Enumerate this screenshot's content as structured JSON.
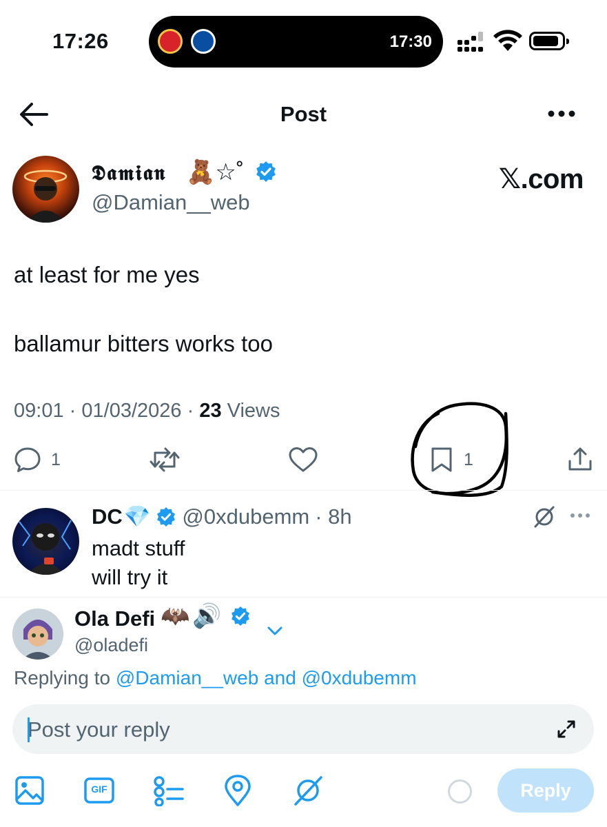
{
  "status_bar": {
    "time": "17:26",
    "live_activity_time": "17:30",
    "live_activity_icons": [
      "arsenal-crest-icon",
      "chelsea-crest-icon"
    ],
    "indicators": [
      "cellular-signal-icon",
      "wifi-icon",
      "battery-icon"
    ]
  },
  "header": {
    "title": "Post",
    "back_icon": "back-arrow-icon",
    "more_icon": "more-options-icon"
  },
  "post": {
    "author_name": "𝕯𝖆𝖒𝖎𝖆𝖓",
    "author_name_decoration": "🧸☆˚",
    "author_handle": "@Damian__web",
    "verified": true,
    "brand_label": "𝕏.com",
    "text_lines": [
      "at least for me yes",
      "ballamur bitters works too"
    ],
    "meta": {
      "time": "09:01",
      "date": "01/03/2026",
      "views_count": "23",
      "views_label": "Views",
      "separator": "·"
    },
    "actions": {
      "reply_count": "1",
      "repost_count": "",
      "like_count": "",
      "bookmark_count": "1"
    }
  },
  "reply": {
    "author_name": "DC",
    "author_name_emoji": "💎",
    "verified": true,
    "author_handle": "@0xdubemm",
    "age": "· 8h",
    "text_lines": [
      "madt stuff",
      "will try it"
    ]
  },
  "composer": {
    "user_name": "Ola Defi",
    "user_name_emoji": [
      "🦇",
      "🔊"
    ],
    "user_handle": "@oladefi",
    "replying_prefix": "Replying to",
    "replying_to_1": "@Damian__web",
    "replying_conjunction": "and",
    "replying_to_2": "@0xdubemm",
    "placeholder": "Post your reply",
    "tools": [
      "image-icon",
      "gif-icon",
      "poll-icon",
      "location-icon",
      "grok-icon"
    ],
    "gif_label": "GIF",
    "reply_button": "Reply"
  },
  "colors": {
    "accent": "#1d9bf0",
    "text": "#0f1419",
    "muted": "#536471",
    "divider": "#eff3f4",
    "reply_button_disabled": "#8ecdf8"
  }
}
